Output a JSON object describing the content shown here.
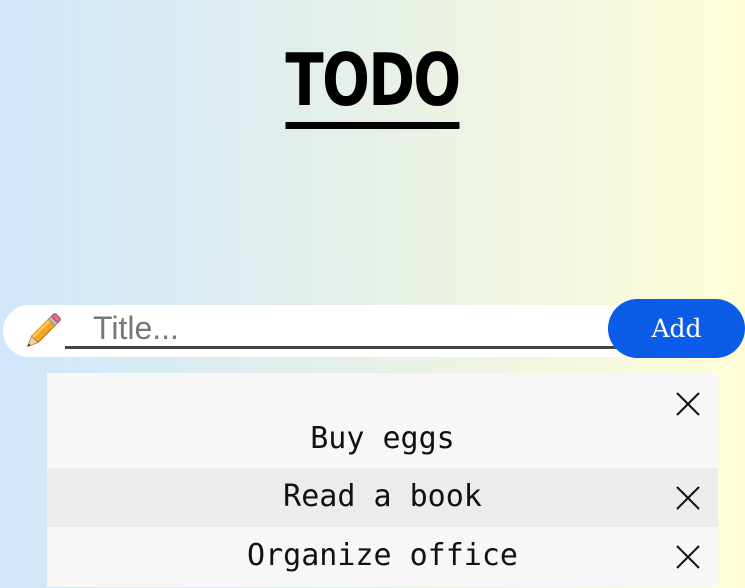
{
  "header": {
    "title": "TODO"
  },
  "form": {
    "input_placeholder": "Title...",
    "input_value": "",
    "add_label": "Add",
    "pencil_icon": "pencil-icon"
  },
  "colors": {
    "accent": "#0b5ce9",
    "gradient_start": "#cfe6fb",
    "gradient_end": "#fffed8"
  },
  "todos": [
    {
      "label": "Buy eggs",
      "close_icon": "close-icon"
    },
    {
      "label": "Read a book",
      "close_icon": "close-icon"
    },
    {
      "label": "Organize office",
      "close_icon": "close-icon"
    }
  ]
}
